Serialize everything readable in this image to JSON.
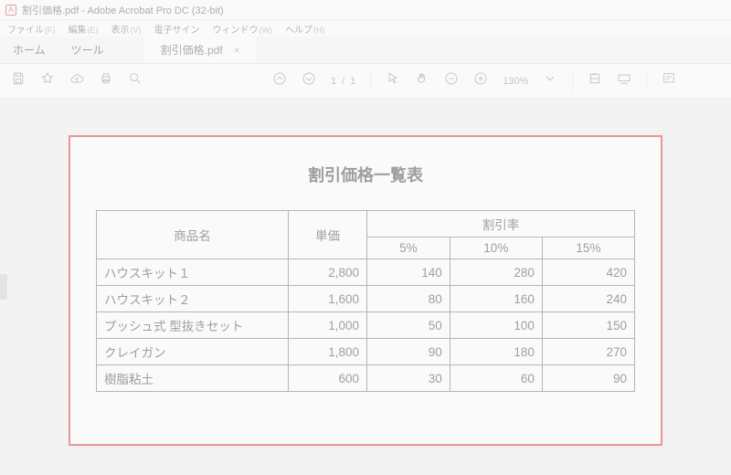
{
  "window": {
    "title": "割引価格.pdf - Adobe Acrobat Pro DC (32-bit)"
  },
  "menubar": {
    "file": "ファイル",
    "file_hint": "(F)",
    "edit": "編集",
    "edit_hint": "(E)",
    "view": "表示",
    "view_hint": "(V)",
    "sign": "電子サイン",
    "window": "ウィンドウ",
    "window_hint": "(W)",
    "help": "ヘルプ",
    "help_hint": "(H)"
  },
  "tabs": {
    "home": "ホーム",
    "tools": "ツール",
    "doc": "割引価格.pdf"
  },
  "toolbar": {
    "page_current": "1",
    "page_sep": "/",
    "page_total": "1",
    "zoom": "130%"
  },
  "document": {
    "title": "割引価格一覧表",
    "headers": {
      "name": "商品名",
      "price": "単価",
      "discount_group": "割引率",
      "d5": "5%",
      "d10": "10%",
      "d15": "15%"
    },
    "rows": [
      {
        "name": "ハウスキット１",
        "price": "2,800",
        "d5": "140",
        "d10": "280",
        "d15": "420"
      },
      {
        "name": "ハウスキット２",
        "price": "1,600",
        "d5": "80",
        "d10": "160",
        "d15": "240"
      },
      {
        "name": "プッシュ式 型抜きセット",
        "price": "1,000",
        "d5": "50",
        "d10": "100",
        "d15": "150"
      },
      {
        "name": "クレイガン",
        "price": "1,800",
        "d5": "90",
        "d10": "180",
        "d15": "270"
      },
      {
        "name": "樹脂粘土",
        "price": "600",
        "d5": "30",
        "d10": "60",
        "d15": "90"
      }
    ]
  }
}
